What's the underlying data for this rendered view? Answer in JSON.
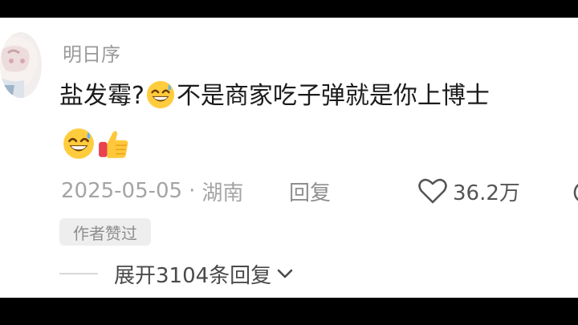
{
  "comment": {
    "username": "明日序",
    "text_part1": "盐发霉?",
    "text_part2": "不是商家吃子弹就是你上博士",
    "emojis_inline": [
      "grinning-sweat-emoji"
    ],
    "emojis_line2": [
      "grinning-sweat-emoji",
      "thumbs-up-emoji"
    ],
    "date": "2025-05-05",
    "dot": "·",
    "location": "湖南",
    "reply_label": "回复",
    "like_count": "36.2万",
    "author_badge": "作者赞过",
    "expand_replies": "展开3104条回复"
  },
  "colors": {
    "background": "#ffffff",
    "letterbox": "#000000",
    "text": "#1b1b1b",
    "muted": "#a4a4a4",
    "emoji_face": "#ffcc3d",
    "thumb": "#ffc83a",
    "cuff": "#e8424e"
  }
}
